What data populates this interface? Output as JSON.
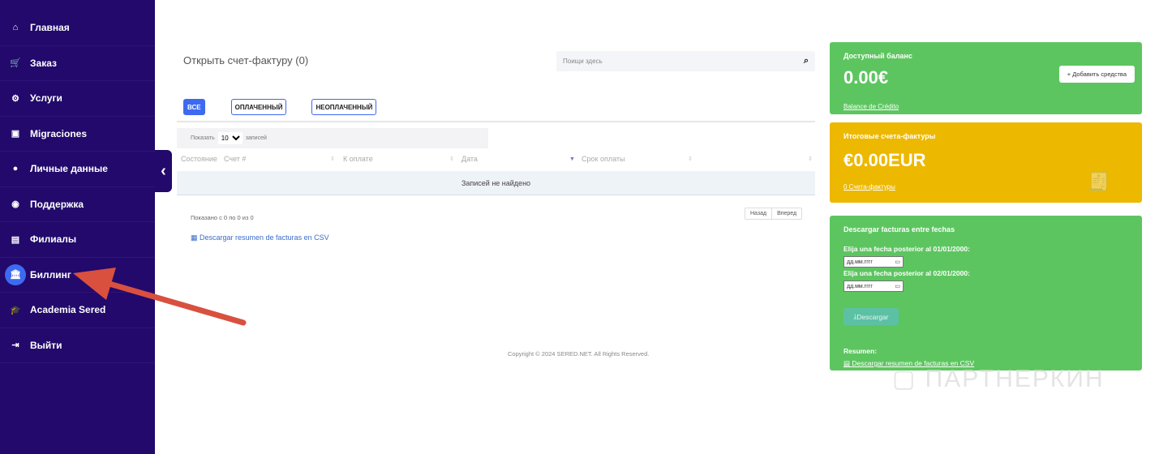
{
  "sidebar": {
    "items": [
      {
        "label": "Главная",
        "icon": "home-icon"
      },
      {
        "label": "Заказ",
        "icon": "cart-icon"
      },
      {
        "label": "Услуги",
        "icon": "cogs-icon"
      },
      {
        "label": "Migraciones",
        "icon": "archive-icon"
      },
      {
        "label": "Личные данные",
        "icon": "user-icon"
      },
      {
        "label": "Поддержка",
        "icon": "lifebuoy-icon"
      },
      {
        "label": "Филиалы",
        "icon": "money-icon"
      },
      {
        "label": "Биллинг",
        "icon": "bank-icon",
        "active": true
      },
      {
        "label": "Academia Sered",
        "icon": "graduation-cap-icon"
      },
      {
        "label": "Выйти",
        "icon": "logout-icon"
      }
    ]
  },
  "main": {
    "title": "Открыть счет-фактуру (0)",
    "search_placeholder": "Поищи здесь",
    "tabs": [
      {
        "label": "ВСЕ"
      },
      {
        "label": "ОПЛАЧЕННЫЙ"
      },
      {
        "label": "НЕОПЛАЧЕННЫЙ"
      }
    ],
    "show_label": "Показать",
    "show_value": "10",
    "show_suffix": "записей",
    "columns": [
      "Состояние",
      "Счет #",
      "К оплате",
      "Дата",
      "Срок оплаты"
    ],
    "empty": "Записей не найдено",
    "info": "Показано с 0 по 0 из 0",
    "prev": "Назад",
    "next": "Вперед",
    "csv_link": "Descargar resumen de facturas en CSV"
  },
  "footer": "Copyright © 2024 SERED.NET. All Rights Reserved.",
  "balance": {
    "title": "Доступный баланс",
    "amount": "0.00€",
    "add_button": "Добавить средства",
    "link": "Balance de Crédito"
  },
  "invoices": {
    "title": "Итоговые счета-фактуры",
    "amount": "€0.00EUR",
    "link": "0 Счета-фактуры"
  },
  "download": {
    "title": "Descargar facturas entre fechas",
    "label1": "Elija una fecha posterior al 01/01/2000:",
    "label2": "Elija una fecha posterior al 02/01/2000:",
    "date_placeholder": "дд.мм.гггг",
    "button": "Descargar",
    "summary": "Resumen:",
    "csv_link": "Descargar resumen de facturas en CSV"
  },
  "watermark": "ПАРТНЕРКИН",
  "colors": {
    "sidebar": "#22096b",
    "accent": "#3d6af0",
    "green": "#5dc560",
    "yellow": "#edb800",
    "arrow": "#d9503f"
  }
}
